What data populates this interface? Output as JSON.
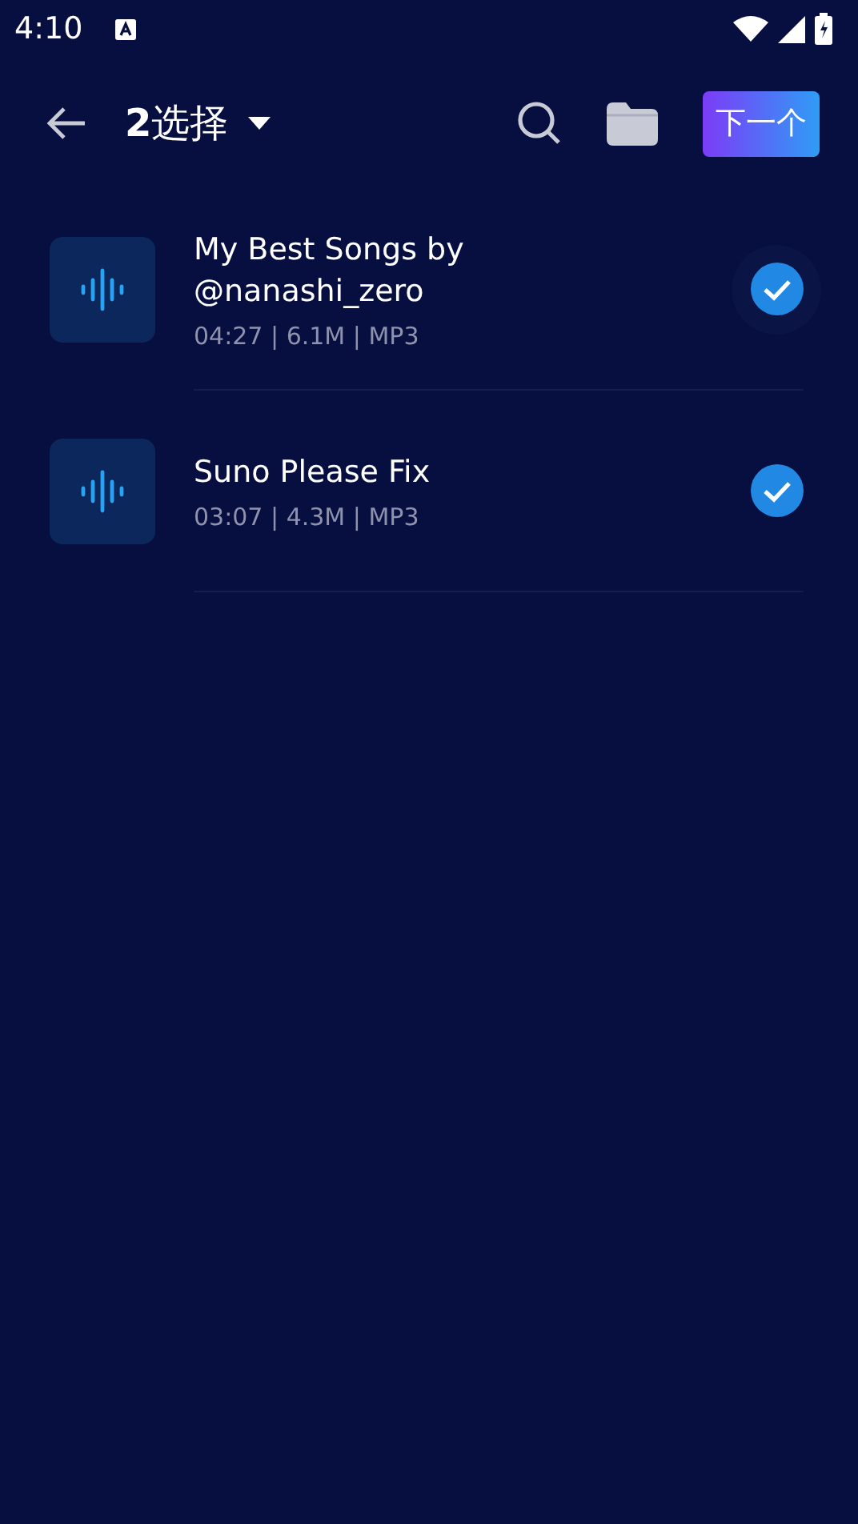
{
  "status_bar": {
    "time": "4:10"
  },
  "toolbar": {
    "title": "**2**选择",
    "next_button": "下一个"
  },
  "files": [
    {
      "title": "My Best Songs by @nanashi_zero",
      "meta": "04:27 | 6.1M | MP3",
      "checked": true
    },
    {
      "title": "Suno Please Fix",
      "meta": "03:07 | 4.3M | MP3",
      "checked": true
    }
  ]
}
